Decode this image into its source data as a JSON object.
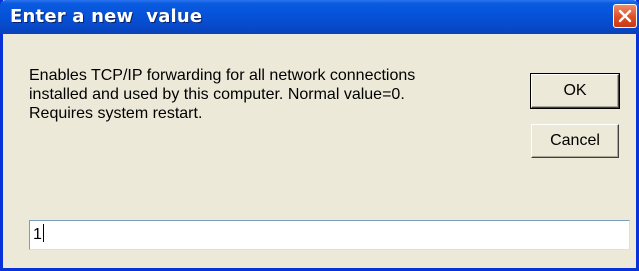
{
  "window": {
    "title": "Enter a new  value"
  },
  "message": {
    "line1": "Enables TCP/IP forwarding for all network connections",
    "line2": "installed and used by this computer. Normal value=0.",
    "line3": "Requires system restart."
  },
  "buttons": {
    "ok_label": "OK",
    "cancel_label": "Cancel"
  },
  "input": {
    "value": "1"
  },
  "icons": {
    "close": "close-icon"
  },
  "colors": {
    "titlebar": "#0552d9",
    "close_button": "#de4e26",
    "dialog_bg": "#ece9d8"
  }
}
